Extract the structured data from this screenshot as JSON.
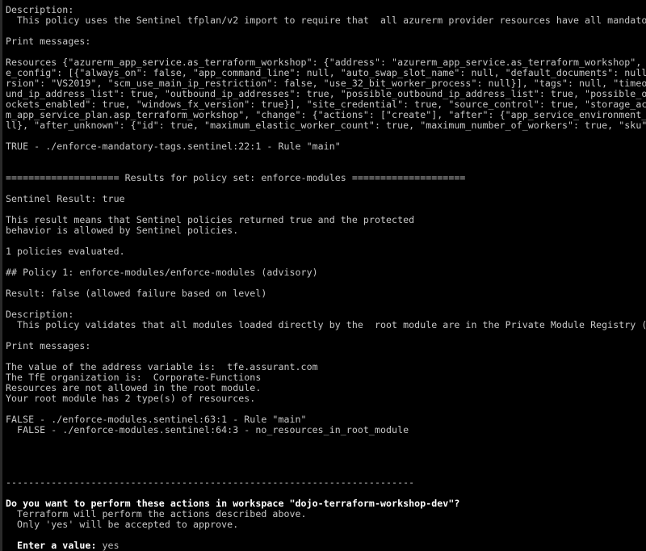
{
  "terminal": {
    "background_color": "#000000",
    "foreground_color": "#c8c8c8",
    "bright_color": "#ffffff",
    "border_color": "#2a2a2a",
    "columns": 110,
    "rows": 52
  },
  "output": {
    "lines": [
      {
        "text": "Description:",
        "style": "normal"
      },
      {
        "text": "  This policy uses the Sentinel tfplan/v2 import to require that  all azurerm provider resources have all mandatory",
        "style": "normal"
      },
      {
        "text": "",
        "style": "blank"
      },
      {
        "text": "Print messages:",
        "style": "normal"
      },
      {
        "text": "",
        "style": "blank"
      },
      {
        "text": "Resources {\"azurerm_app_service.as_terraform_workshop\": {\"address\": \"azurerm_app_service.as_terraform_workshop\", \"",
        "style": "normal"
      },
      {
        "text": "e_config\": [{\"always_on\": false, \"app_command_line\": null, \"auto_swap_slot_name\": null, \"default_documents\": null,",
        "style": "normal"
      },
      {
        "text": "rsion\": \"VS2019\", \"scm_use_main_ip_restriction\": false, \"use_32_bit_worker_process\": null}], \"tags\": null, \"timeou",
        "style": "normal"
      },
      {
        "text": "und_ip_address_list\": true, \"outbound_ip_addresses\": true, \"possible_outbound_ip_address_list\": true, \"possible_ou",
        "style": "normal"
      },
      {
        "text": "ockets_enabled\": true, \"windows_fx_version\": true}], \"site_credential\": true, \"source_control\": true, \"storage_acc",
        "style": "normal"
      },
      {
        "text": "m_app_service_plan.asp_terraform_workshop\", \"change\": {\"actions\": [\"create\"], \"after\": {\"app_service_environment_i",
        "style": "normal"
      },
      {
        "text": "ll}, \"after_unknown\": {\"id\": true, \"maximum_elastic_worker_count\": true, \"maximum_number_of_workers\": true, \"sku\":",
        "style": "normal"
      },
      {
        "text": "",
        "style": "blank"
      },
      {
        "text": "TRUE - ./enforce-mandatory-tags.sentinel:22:1 - Rule \"main\"",
        "style": "normal"
      },
      {
        "text": "",
        "style": "blank"
      },
      {
        "text": "",
        "style": "blank"
      },
      {
        "text": "==================== Results for policy set: enforce-modules ====================",
        "style": "normal"
      },
      {
        "text": "",
        "style": "blank"
      },
      {
        "text": "Sentinel Result: true",
        "style": "normal"
      },
      {
        "text": "",
        "style": "blank"
      },
      {
        "text": "This result means that Sentinel policies returned true and the protected",
        "style": "normal"
      },
      {
        "text": "behavior is allowed by Sentinel policies.",
        "style": "normal"
      },
      {
        "text": "",
        "style": "blank"
      },
      {
        "text": "1 policies evaluated.",
        "style": "normal"
      },
      {
        "text": "",
        "style": "blank"
      },
      {
        "text": "## Policy 1: enforce-modules/enforce-modules (advisory)",
        "style": "normal"
      },
      {
        "text": "",
        "style": "blank"
      },
      {
        "text": "Result: false (allowed failure based on level)",
        "style": "normal"
      },
      {
        "text": "",
        "style": "blank"
      },
      {
        "text": "Description:",
        "style": "normal"
      },
      {
        "text": "  This policy validates that all modules loaded directly by the  root module are in the Private Module Registry (P",
        "style": "normal"
      },
      {
        "text": "",
        "style": "blank"
      },
      {
        "text": "Print messages:",
        "style": "normal"
      },
      {
        "text": "",
        "style": "blank"
      },
      {
        "text": "The value of the address variable is:  tfe.assurant.com",
        "style": "normal"
      },
      {
        "text": "The TfE organization is:  Corporate-Functions",
        "style": "normal"
      },
      {
        "text": "Resources are not allowed in the root module.",
        "style": "normal"
      },
      {
        "text": "Your root module has 2 type(s) of resources.",
        "style": "normal"
      },
      {
        "text": "",
        "style": "blank"
      },
      {
        "text": "FALSE - ./enforce-modules.sentinel:63:1 - Rule \"main\"",
        "style": "normal"
      },
      {
        "text": "  FALSE - ./enforce-modules.sentinel:64:3 - no_resources_in_root_module",
        "style": "normal"
      },
      {
        "text": "",
        "style": "blank"
      },
      {
        "text": "",
        "style": "blank"
      },
      {
        "text": "",
        "style": "blank"
      },
      {
        "text": "",
        "style": "blank"
      },
      {
        "text": "------------------------------------------------------------------------",
        "style": "normal"
      },
      {
        "text": "",
        "style": "blank"
      },
      {
        "text": "Do you want to perform these actions in workspace \"dojo-terraform-workshop-dev\"?",
        "style": "bold"
      },
      {
        "text": "  Terraform will perform the actions described above.",
        "style": "normal"
      },
      {
        "text": "  Only 'yes' will be accepted to approve.",
        "style": "normal"
      },
      {
        "text": "",
        "style": "blank"
      },
      {
        "text": "  Enter a value: yes",
        "style": "prompt",
        "segments": [
          {
            "text": "  Enter a value:",
            "kind": "bold"
          },
          {
            "text": " yes",
            "kind": "dim"
          }
        ]
      }
    ]
  }
}
